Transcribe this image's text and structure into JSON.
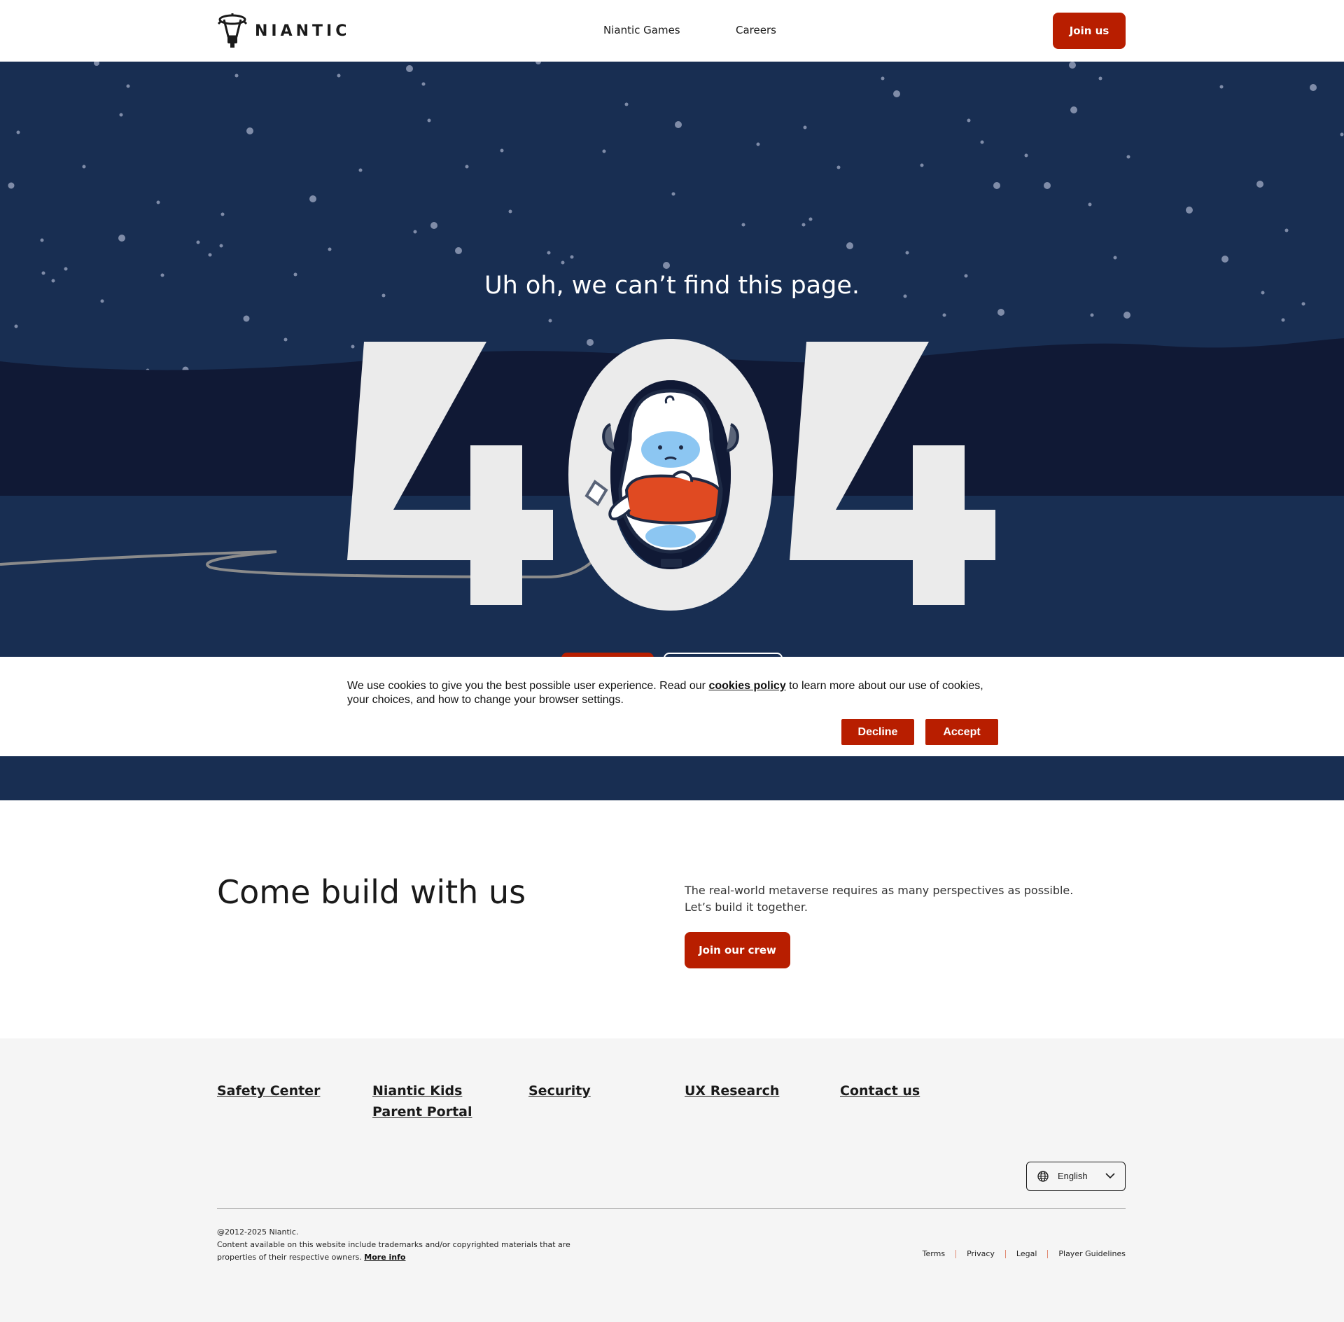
{
  "header": {
    "logo_text": "NIANTIC",
    "nav": [
      {
        "label": "Niantic Games"
      },
      {
        "label": "Careers"
      }
    ],
    "join_label": "Join us"
  },
  "hero": {
    "title": "Uh oh, we can’t find this page.",
    "digits": [
      "4",
      "0",
      "4"
    ],
    "colors": {
      "sky": "#182e52",
      "mountains": "#101935",
      "digit": "#ebebeb",
      "accent": "#b81e00"
    }
  },
  "cookie": {
    "text_before": "We use cookies to give you the best possible user experience. Read our ",
    "link_label": "cookies policy",
    "text_after": " to learn more about our use of cookies, your choices, and how to change your browser settings.",
    "decline_label": "Decline",
    "accept_label": "Accept"
  },
  "build": {
    "title": "Come build with us",
    "line1": "The real-world metaverse requires as many perspectives as possible.",
    "line2": "Let’s build it together.",
    "button_label": "Join our crew"
  },
  "footer": {
    "links": [
      {
        "label": "Safety Center"
      },
      {
        "label": "Niantic Kids Parent Portal"
      },
      {
        "label": "Security"
      },
      {
        "label": "UX Research"
      },
      {
        "label": "Contact us"
      }
    ],
    "language": "English",
    "copyright": "@2012-2025 Niantic.",
    "notice": "Content available on this website include trademarks and/or copyrighted materials that are properties of their respective owners. ",
    "more_info": "More info",
    "legal": [
      {
        "label": "Terms"
      },
      {
        "label": "Privacy"
      },
      {
        "label": "Legal"
      },
      {
        "label": "Player Guidelines"
      }
    ]
  }
}
